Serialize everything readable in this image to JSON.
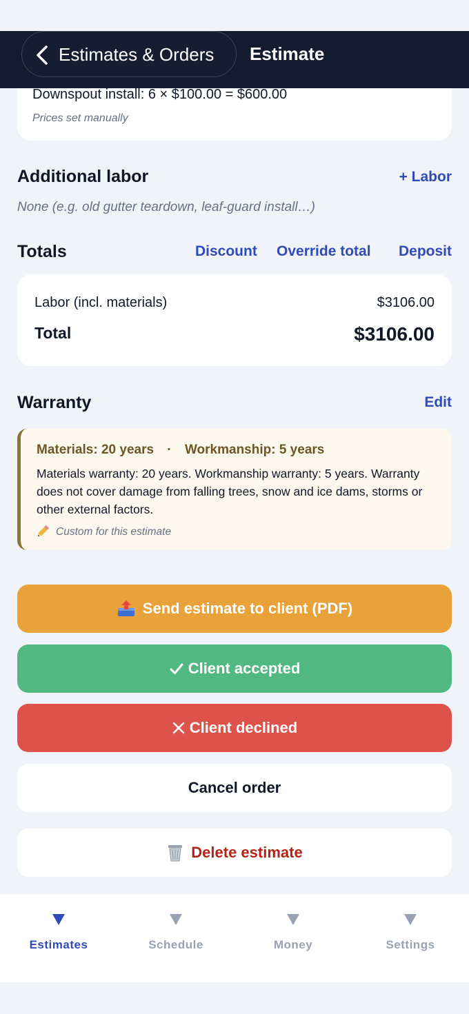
{
  "header": {
    "back_label": "Estimates & Orders",
    "title": "Estimate"
  },
  "line_items": {
    "item": "Downspout install: 6 × $100.00 = $600.00",
    "note": "Prices set manually"
  },
  "additional_labor": {
    "title": "Additional labor",
    "add_link": "+ Labor",
    "empty_text": "None (e.g. old gutter teardown, leaf-guard install…)"
  },
  "totals": {
    "title": "Totals",
    "actions": [
      "Discount",
      "Override total",
      "Deposit"
    ],
    "labor_label": "Labor (incl. materials)",
    "labor_value": "$3106.00",
    "total_label": "Total",
    "total_value": "$3106.00"
  },
  "warranty": {
    "title": "Warranty",
    "edit_link": "Edit",
    "materials": "Materials: 20 years",
    "separator": "·",
    "workmanship": "Workmanship: 5 years",
    "body": "Materials warranty: 20 years. Workmanship warranty: 5 years. Warranty does not cover damage from falling trees, snow and ice dams, storms or other external factors.",
    "note": "Custom for this estimate",
    "accent_color": "#8a7437"
  },
  "actions": {
    "send": "Send estimate to client (PDF)",
    "accept": "Client accepted",
    "decline": "Client declined",
    "cancel": "Cancel order",
    "delete": "Delete estimate"
  },
  "tabs": [
    {
      "label": "Estimates",
      "active": true
    },
    {
      "label": "Schedule",
      "active": false
    },
    {
      "label": "Money",
      "active": false
    },
    {
      "label": "Settings",
      "active": false
    }
  ],
  "colors": {
    "navbar": "#131b2e",
    "link": "#2e4bb7",
    "send": "#e9a139",
    "accept": "#52b882",
    "decline": "#de524c",
    "delete_text": "#b42318"
  }
}
